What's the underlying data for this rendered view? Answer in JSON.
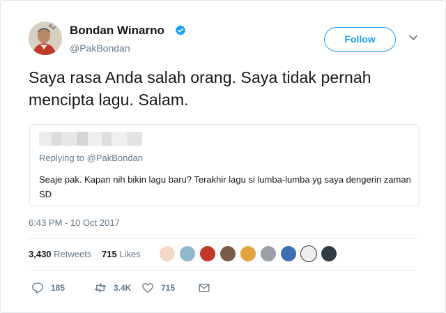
{
  "author": {
    "name": "Bondan Winarno",
    "handle": "@PakBondan",
    "follow_label": "Follow",
    "verified_color": "#1da1f2"
  },
  "tweet": {
    "text": "Saya rasa Anda salah orang. Saya tidak pernah mencipta lagu. Salam.",
    "timestamp": "6:43 PM - 10 Oct 2017"
  },
  "quoted_tweet": {
    "replying_to": "Replying to @PakBondan",
    "text": "Seaje pak. Kapan nih bikin lagu baru? Terakhir lagu si lumba-lumba yg saya dengerin zaman SD"
  },
  "stats": {
    "retweets_count": "3,430",
    "retweets_label": "Retweets",
    "likes_count": "715",
    "likes_label": "Likes"
  },
  "actions": {
    "replies": "185",
    "retweets": "3.4K",
    "likes": "715"
  },
  "colors": {
    "accent": "#1da1f2",
    "secondary_text": "#657786",
    "border": "#e1e8ed"
  },
  "likers_count_shown": 9
}
